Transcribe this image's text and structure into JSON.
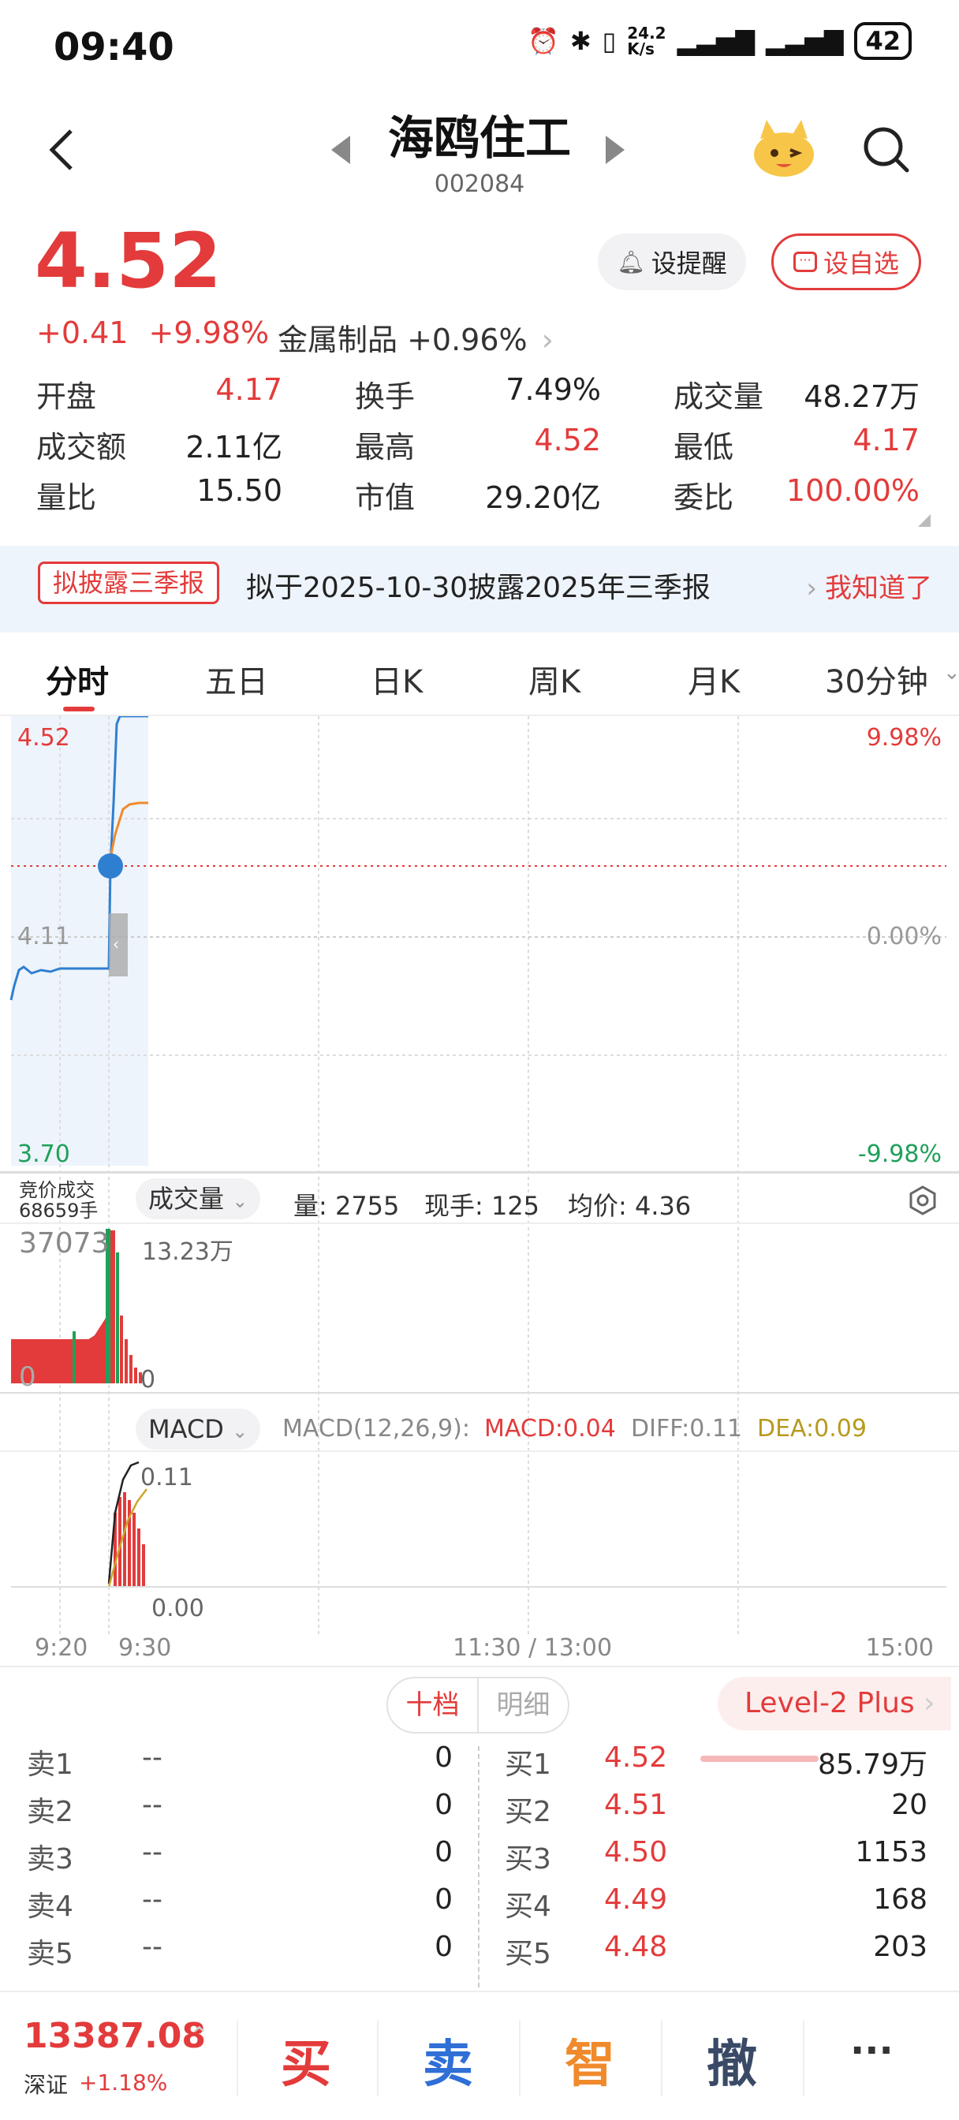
{
  "status": {
    "time": "09:40",
    "net_speed": "24.2\nK/s",
    "battery": "42"
  },
  "header": {
    "name": "海鸥住工",
    "code": "002084"
  },
  "quote": {
    "price": "4.52",
    "change": "+0.41",
    "change_pct": "+9.98%",
    "industry": "金属制品 +0.96%",
    "remind_label": "设提醒",
    "watch_label": "设自选"
  },
  "stats": [
    {
      "label": "开盘",
      "value": "4.17",
      "color": "#e33b3b"
    },
    {
      "label": "换手",
      "value": "7.49%",
      "color": "#222222"
    },
    {
      "label": "成交量",
      "value": "48.27万",
      "color": "#222222"
    },
    {
      "label": "成交额",
      "value": "2.11亿",
      "color": "#222222"
    },
    {
      "label": "最高",
      "value": "4.52",
      "color": "#e33b3b"
    },
    {
      "label": "最低",
      "value": "4.17",
      "color": "#e33b3b"
    },
    {
      "label": "量比",
      "value": "15.50",
      "color": "#222222"
    },
    {
      "label": "市值",
      "value": "29.20亿",
      "color": "#222222"
    },
    {
      "label": "委比",
      "value": "100.00%",
      "color": "#e33b3b"
    }
  ],
  "notice": {
    "tag": "拟披露三季报",
    "text": "拟于2025-10-30披露2025年三季报",
    "dismiss": "我知道了"
  },
  "tabs": [
    "分时",
    "五日",
    "日K",
    "周K",
    "月K",
    "30分钟"
  ],
  "chart": {
    "price_high": "4.52",
    "price_mid": "4.11",
    "price_low": "3.70",
    "pct_high": "9.98%",
    "pct_mid": "0.00%",
    "pct_low": "-9.98%",
    "auction_label": "竞价成交\n68659手",
    "volume_pill": "成交量",
    "volume_info": "量: 2755",
    "current_hand": "现手: 125",
    "avg_price": "均价: 4.36",
    "vol_max": "13.23万",
    "vol_zero": "0",
    "auction_vol": "37073",
    "auction_zero": "0",
    "macd_pill": "MACD",
    "macd_params": "MACD(12,26,9):",
    "macd_value": "MACD:0.04",
    "diff_value": "DIFF:0.11",
    "dea_value": "DEA:0.09",
    "macd_max": "0.11",
    "macd_zero": "0.00",
    "time_labels": [
      "9:20",
      "9:30",
      "11:30 / 13:00",
      "15:00"
    ],
    "colors": {
      "price_line": "#2f7fd1",
      "avg_line": "#f08a2c",
      "up": "#e33b3b",
      "down": "#1fa05a"
    }
  },
  "order_book": {
    "tab_depth": "十档",
    "tab_detail": "明细",
    "level2_label": "Level-2 Plus",
    "sells": [
      {
        "label": "卖1",
        "price": "--",
        "vol": "0"
      },
      {
        "label": "卖2",
        "price": "--",
        "vol": "0"
      },
      {
        "label": "卖3",
        "price": "--",
        "vol": "0"
      },
      {
        "label": "卖4",
        "price": "--",
        "vol": "0"
      },
      {
        "label": "卖5",
        "price": "--",
        "vol": "0"
      }
    ],
    "buys": [
      {
        "label": "买1",
        "price": "4.52",
        "vol": "85.79万"
      },
      {
        "label": "买2",
        "price": "4.51",
        "vol": "20"
      },
      {
        "label": "买3",
        "price": "4.50",
        "vol": "1153"
      },
      {
        "label": "买4",
        "price": "4.49",
        "vol": "168"
      },
      {
        "label": "买5",
        "price": "4.48",
        "vol": "203"
      }
    ]
  },
  "bottom": {
    "index_value": "13387.08",
    "index_name": "深证",
    "index_change": "+1.18%",
    "buy": "买",
    "sell": "卖",
    "smart": "智",
    "cancel": "撤",
    "more": "···",
    "colors": {
      "buy": "#e33b3b",
      "sell": "#2f6fd6",
      "smart": "#f08a2c",
      "cancel": "#3a4a66"
    }
  }
}
